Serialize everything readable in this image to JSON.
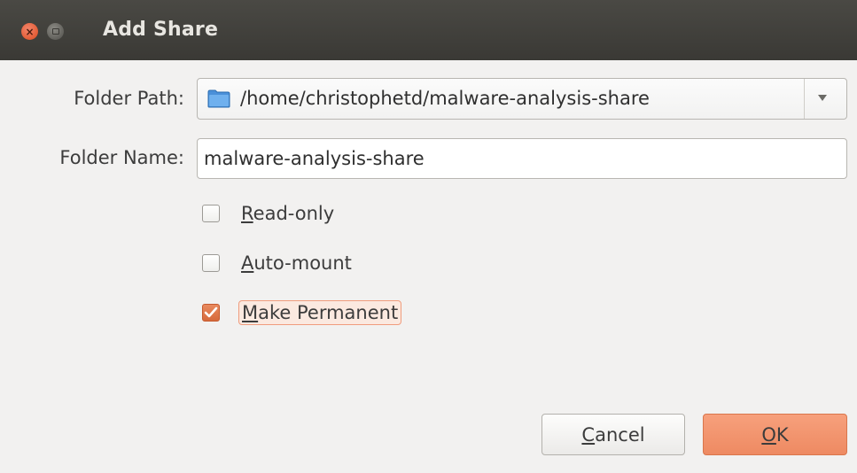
{
  "window": {
    "title": "Add Share",
    "close_glyph": "×"
  },
  "form": {
    "folder_path_label": "Folder Path:",
    "folder_path_value": "/home/christophetd/malware-analysis-share",
    "folder_name_label": "Folder Name:",
    "folder_name_value": "malware-analysis-share"
  },
  "options": {
    "read_only": {
      "mnemonic": "R",
      "rest": "ead-only",
      "checked": false
    },
    "auto_mount": {
      "mnemonic": "A",
      "rest": "uto-mount",
      "checked": false
    },
    "make_permanent": {
      "mnemonic": "M",
      "rest": "ake Permanent",
      "checked": true
    }
  },
  "buttons": {
    "cancel": {
      "mnemonic": "C",
      "rest": "ancel"
    },
    "ok": {
      "mnemonic": "O",
      "rest": "K"
    }
  },
  "colors": {
    "accent": "#ee8a62",
    "titlebar": "#3f3e3a",
    "background": "#f2f1f0"
  },
  "icons": {
    "close": "close-icon",
    "maximize": "maximize-icon",
    "folder": "folder-icon",
    "dropdown": "chevron-down-icon",
    "check": "checkmark-icon"
  }
}
